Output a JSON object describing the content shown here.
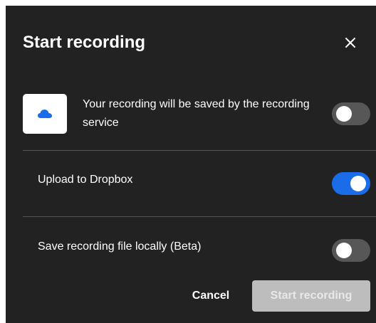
{
  "dialog": {
    "title": "Start recording",
    "close_icon": "close-icon"
  },
  "options": [
    {
      "label": "Your recording will be saved by the recording service",
      "icon": "cloud-icon",
      "enabled": false
    },
    {
      "label": "Upload to Dropbox",
      "enabled": true
    },
    {
      "label": "Save recording file locally (Beta)",
      "enabled": false
    }
  ],
  "footer": {
    "cancel_label": "Cancel",
    "start_label": "Start recording",
    "start_disabled": true
  },
  "colors": {
    "dialog_background": "#222222",
    "toggle_on": "#1a6ce8",
    "toggle_off": "#575757",
    "cloud_icon": "#1a6ce8",
    "disabled_button": "#bdbdbd"
  }
}
